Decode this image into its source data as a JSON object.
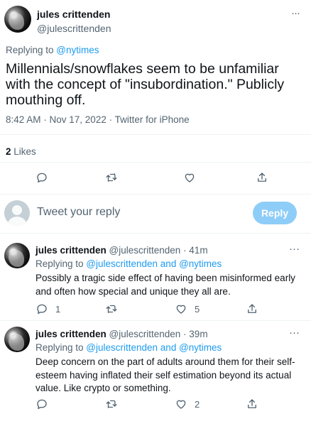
{
  "main_tweet": {
    "author_name": "jules crittenden",
    "author_handle": "@julescrittenden",
    "more": "···",
    "replying_prefix": "Replying to ",
    "replying_handle": "@nytimes",
    "text": "Millennials/snowflakes seem to be unfamiliar with the concept of \"insubordination.\" Publicly mouthing off.",
    "timestamp": "8:42 AM · Nov 17, 2022 · Twitter for iPhone",
    "likes_count": "2",
    "likes_label": " Likes"
  },
  "compose": {
    "placeholder": "Tweet your reply",
    "reply_label": "Reply"
  },
  "replies": [
    {
      "author_name": "jules crittenden",
      "author_handle": "@julescrittenden · 41m",
      "replying_prefix": "Replying to ",
      "replying_handles": "@julescrittenden and @nytimes",
      "text": "Possibly a tragic side effect of having been misinformed early and often how special and unique they all are.",
      "reply_count": "1",
      "retweet_count": "",
      "like_count": "5"
    },
    {
      "author_name": "jules crittenden",
      "author_handle": "@julescrittenden · 39m",
      "replying_prefix": "Replying to ",
      "replying_handles": "@julescrittenden and @nytimes",
      "text": "Deep concern on the part of adults around them for their self-esteem having inflated their self estimation beyond its actual value. Like crypto or something.",
      "reply_count": "",
      "retweet_count": "",
      "like_count": "2"
    }
  ],
  "icons": {
    "reply": "reply-icon",
    "retweet": "retweet-icon",
    "like": "heart-icon",
    "share": "share-icon",
    "more": "more-icon"
  },
  "colors": {
    "link": "#1d9bf0",
    "secondary_text": "#536471",
    "reply_button_disabled": "#8ecdf8"
  }
}
